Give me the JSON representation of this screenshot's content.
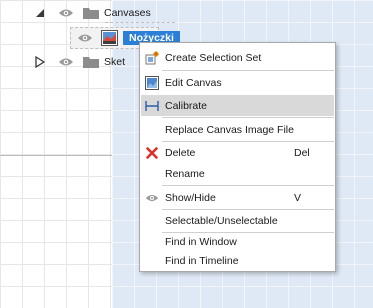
{
  "tree": {
    "folder_label": "Canvases",
    "item_label": "Nożyczki",
    "sketches_label": "Sket"
  },
  "menu": {
    "items": [
      {
        "label": "Create Selection Set",
        "shortcut": "",
        "icon": "selection-set-icon"
      },
      {
        "label": "Edit Canvas",
        "shortcut": "",
        "icon": "canvas-icon"
      },
      {
        "label": "Calibrate",
        "shortcut": "",
        "icon": "calibrate-icon"
      },
      {
        "label": "Replace Canvas Image File",
        "shortcut": "",
        "icon": ""
      },
      {
        "label": "Delete",
        "shortcut": "Del",
        "icon": "delete-icon"
      },
      {
        "label": "Rename",
        "shortcut": "",
        "icon": ""
      },
      {
        "label": "Show/Hide",
        "shortcut": "V",
        "icon": "eye-icon"
      },
      {
        "label": "Selectable/Unselectable",
        "shortcut": "",
        "icon": ""
      },
      {
        "label": "Find in Window",
        "shortcut": "",
        "icon": ""
      },
      {
        "label": "Find in Timeline",
        "shortcut": "",
        "icon": ""
      }
    ],
    "highlighted": "Calibrate"
  },
  "colors": {
    "selection_blue": "#2b7fd6",
    "delete_red": "#d9302c",
    "highlight_gray": "#d9d9d9"
  }
}
